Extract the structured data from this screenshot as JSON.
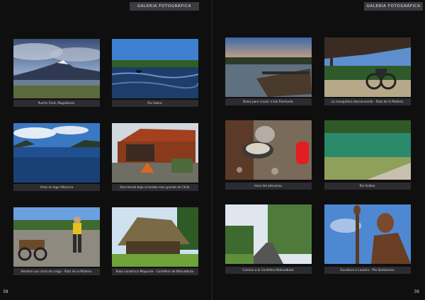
{
  "left_page": {
    "header": "GALERIA FOTOGRÁFICA",
    "page_number": "38",
    "photos": [
      {
        "caption": "Puerto Fivat, Magallanes."
      },
      {
        "caption": "Rio Sabra."
      },
      {
        "caption": "Vista en lago Villarrica"
      },
      {
        "caption": "Dormiendo bajo el tambo mas grande de Chile."
      },
      {
        "caption": "Hombre con carro de carga - Ruta de la Madera."
      },
      {
        "caption": "Ruka conatruca Mapuche - Cordillera de Nahuelbuta."
      }
    ]
  },
  "right_page": {
    "header": "GALERIA FOTOGRÁFICA",
    "page_number": "39",
    "photos": [
      {
        "caption": "Balsa para cruzar a Isla Riamuela."
      },
      {
        "caption": "La mosquitera descansando - Ruta de la Madera."
      },
      {
        "caption": "Hora del almuerzo."
      },
      {
        "caption": "Rio Vuldos."
      },
      {
        "caption": "Camino a la Cordillera Nahuelbuta."
      },
      {
        "caption": "Escultura a Lautaro - Pto Santiamiro."
      }
    ]
  }
}
